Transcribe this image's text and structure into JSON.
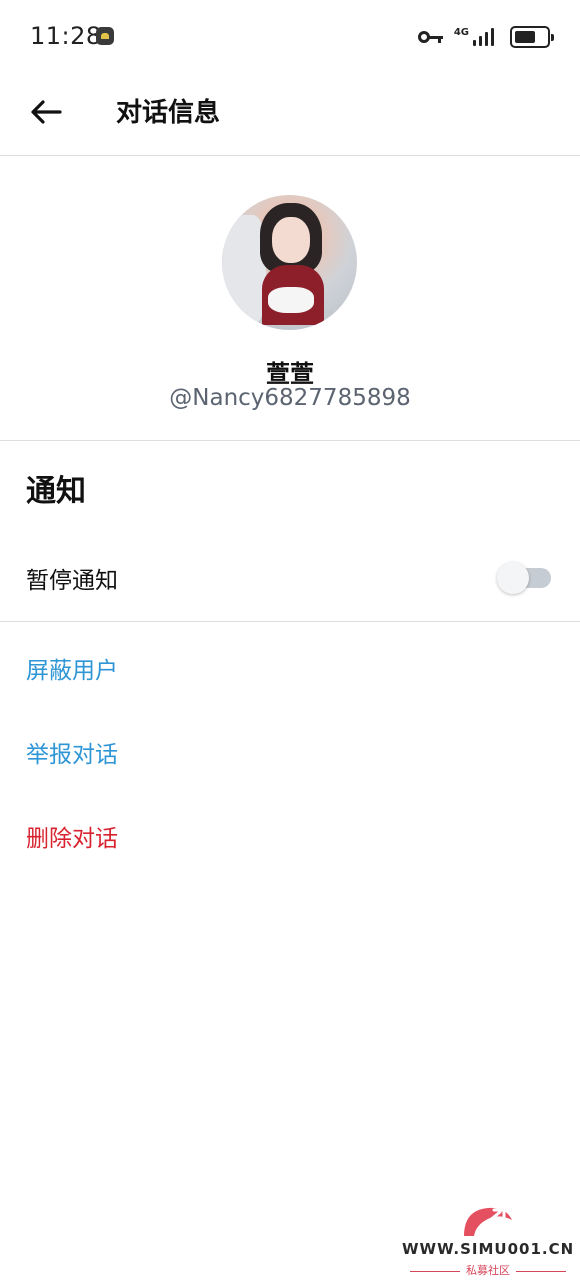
{
  "status_bar": {
    "time": "11:28",
    "network": "4G",
    "icons": [
      "app-notification-icon",
      "vpn-key-icon",
      "signal-icon",
      "battery-icon"
    ]
  },
  "header": {
    "back_icon": "arrow-left-icon",
    "title": "对话信息"
  },
  "profile": {
    "display_name": "萱萱",
    "handle": "@Nancy6827785898"
  },
  "notifications": {
    "section_title": "通知",
    "mute_label": "暂停通知",
    "mute_enabled": false
  },
  "actions": {
    "block": "屏蔽用户",
    "report": "举报对话",
    "delete": "删除对话"
  },
  "colors": {
    "action_blue": "#2f96d6",
    "danger_red": "#d8232f",
    "divider": "#dcdfe2"
  },
  "watermark": {
    "url": "WWW.SIMU001.CN",
    "subtitle": "私募社区"
  }
}
